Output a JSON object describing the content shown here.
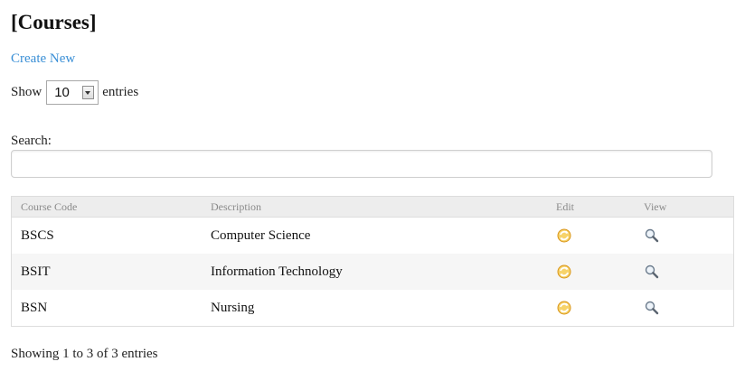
{
  "page": {
    "title": "[Courses]",
    "create_link": "Create New"
  },
  "length_menu": {
    "prefix": "Show",
    "value": "10",
    "suffix": "entries"
  },
  "search": {
    "label": "Search:",
    "value": "",
    "placeholder": ""
  },
  "table": {
    "columns": [
      "Course Code",
      "Description",
      "Edit",
      "View"
    ],
    "rows": [
      {
        "code": "BSCS",
        "description": "Computer Science",
        "edit_icon": "refresh-edit-icon",
        "view_icon": "magnifier-icon"
      },
      {
        "code": "BSIT",
        "description": "Information Technology",
        "edit_icon": "refresh-edit-icon",
        "view_icon": "magnifier-icon"
      },
      {
        "code": "BSN",
        "description": "Nursing",
        "edit_icon": "refresh-edit-icon",
        "view_icon": "magnifier-icon"
      }
    ]
  },
  "footer": {
    "info": "Showing 1 to 3 of 3 entries"
  },
  "colors": {
    "link": "#3a8fd6",
    "header_bg": "#ededed",
    "row_alt_bg": "#f6f6f6",
    "edit_icon": "#e8a21c"
  }
}
